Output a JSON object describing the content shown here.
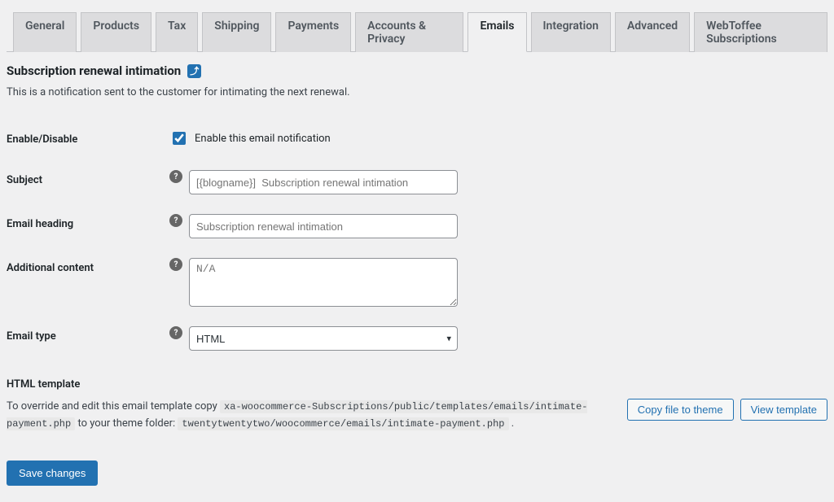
{
  "tabs": {
    "items": [
      {
        "label": "General"
      },
      {
        "label": "Products"
      },
      {
        "label": "Tax"
      },
      {
        "label": "Shipping"
      },
      {
        "label": "Payments"
      },
      {
        "label": "Accounts & Privacy"
      },
      {
        "label": "Emails",
        "active": true
      },
      {
        "label": "Integration"
      },
      {
        "label": "Advanced"
      },
      {
        "label": "WebToffee Subscriptions"
      }
    ]
  },
  "heading": {
    "title": "Subscription renewal intimation",
    "back_glyph": "⤴",
    "description": "This is a notification sent to the customer for intimating the next renewal."
  },
  "fields": {
    "enable": {
      "label": "Enable/Disable",
      "checkbox_label": "Enable this email notification",
      "checked": true
    },
    "subject": {
      "label": "Subject",
      "placeholder": "[{blogname}]  Subscription renewal intimation",
      "value": ""
    },
    "email_heading": {
      "label": "Email heading",
      "placeholder": "Subscription renewal intimation",
      "value": ""
    },
    "additional_content": {
      "label": "Additional content",
      "placeholder": "N/A",
      "value": ""
    },
    "email_type": {
      "label": "Email type",
      "selected": "HTML"
    }
  },
  "html_template": {
    "heading": "HTML template",
    "prefix": "To override and edit this email template copy",
    "source_path": "xa-woocommerce-Subscriptions/public/templates/emails/intimate-payment.php",
    "middle": "to your theme folder:",
    "dest_path": "twentytwentytwo/woocommerce/emails/intimate-payment.php",
    "suffix": ".",
    "copy_button": "Copy file to theme",
    "view_button": "View template"
  },
  "actions": {
    "save": "Save changes"
  }
}
